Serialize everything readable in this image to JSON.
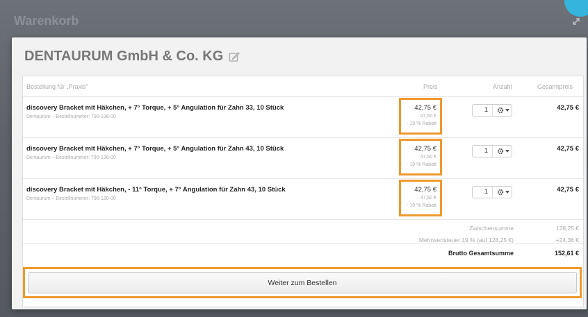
{
  "window": {
    "title": "Warenkorb"
  },
  "company": {
    "name": "DENTAURUM GmbH & Co. KG"
  },
  "table": {
    "order_for": "Bestellung für „Praxis“",
    "col_price": "Preis",
    "col_qty": "Anzahl",
    "col_total": "Gesamtpreis"
  },
  "items": [
    {
      "title": "discovery Bracket mit Häkchen, + 7° Torque, + 5° Angulation für Zahn 33, 10 Stück",
      "subtitle": "Dentaurum – Bestellnummer: 790-138-00",
      "price": "42,75 €",
      "old_price": "47,50 €",
      "discount": "- 10 % Rabatt",
      "qty": "1",
      "total": "42,75 €"
    },
    {
      "title": "discovery Bracket mit Häkchen, + 7° Torque, + 5° Angulation für Zahn 43, 10 Stück",
      "subtitle": "Dentaurum – Bestellnummer: 790-138-00",
      "price": "42,75 €",
      "old_price": "47,50 €",
      "discount": "- 10 % Rabatt",
      "qty": "1",
      "total": "42,75 €"
    },
    {
      "title": "discovery Bracket mit Häkchen, - 11° Torque, + 7° Angulation für Zahn 43, 10 Stück",
      "subtitle": "Dentaurum – Bestellnummer: 790-120-00",
      "price": "42,75 €",
      "old_price": "47,50 €",
      "discount": "- 10 % Rabatt",
      "qty": "1",
      "total": "42,75 €"
    }
  ],
  "summary": {
    "subtotal_label": "Zwischensumme",
    "subtotal_value": "128,25 €",
    "vat_label": "Mehrwertsteuer 19 % (auf 128,25 €)",
    "vat_value": "+24,36 €",
    "gross_label": "Brutto Gesamtsumme",
    "gross_value": "152,61 €"
  },
  "actions": {
    "order_label": "Weiter zum Bestellen"
  },
  "colors": {
    "highlight": "#f0982d",
    "badge": "#35b4de"
  }
}
